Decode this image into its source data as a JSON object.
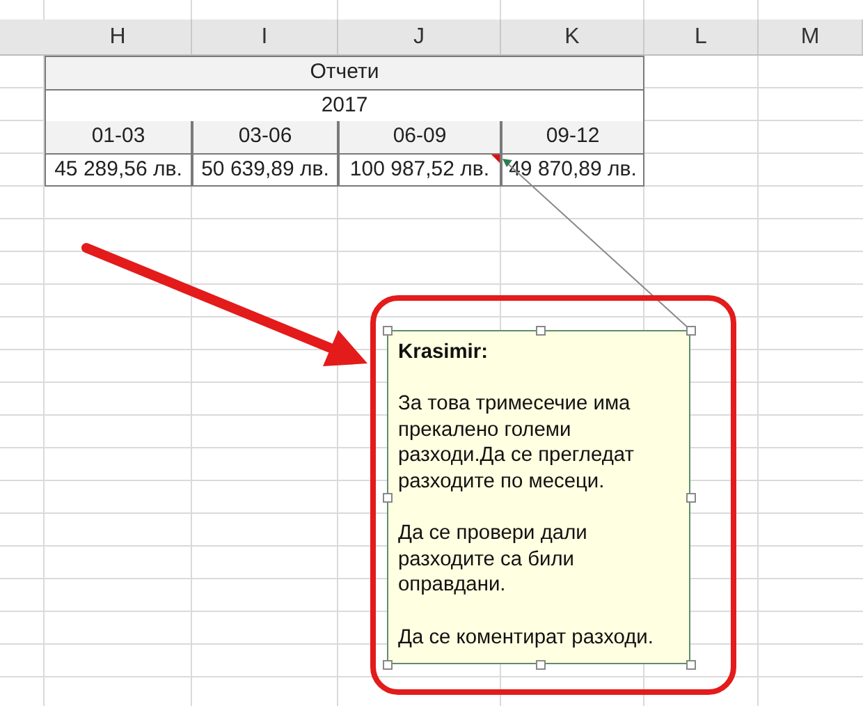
{
  "columns": [
    {
      "label": "H"
    },
    {
      "label": "I"
    },
    {
      "label": "J"
    },
    {
      "label": "K"
    },
    {
      "label": "L"
    },
    {
      "label": "M"
    }
  ],
  "table": {
    "title": "Отчети",
    "year": "2017",
    "periods": [
      "01-03",
      "03-06",
      "06-09",
      "09-12"
    ],
    "values": [
      {
        "text": "45 289,56 лв.",
        "has_comment": false
      },
      {
        "text": "50 639,89 лв.",
        "has_comment": false
      },
      {
        "text": "100 987,52 лв.",
        "has_comment": true
      },
      {
        "text": "49 870,89 лв.",
        "has_comment": false
      }
    ]
  },
  "comment": {
    "author": "Krasimir:",
    "paragraphs": [
      "За това тримесечие има прекалено големи разходи.Да се прегледат разходите по месеци.",
      "Да се провери дали разходите са били оправдани.",
      "Да се коментират разходи."
    ]
  }
}
